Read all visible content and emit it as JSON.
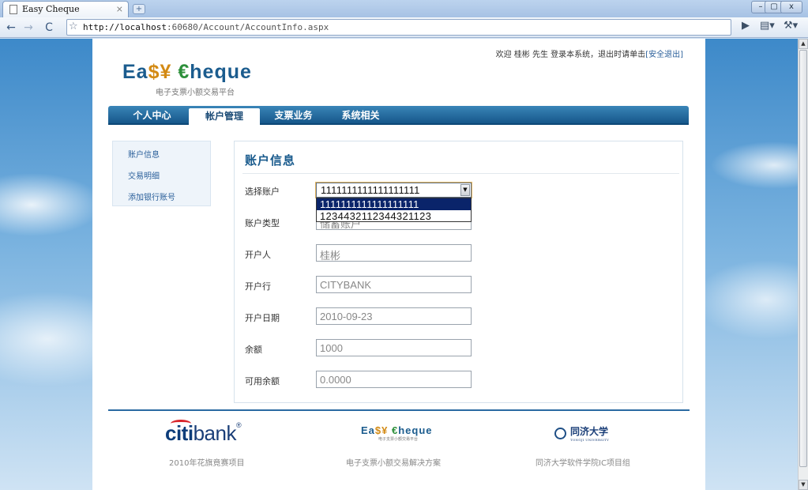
{
  "browser": {
    "tab_title": "Easy Cheque",
    "tab_close": "×",
    "url_host": "http://localhost",
    "url_rest": ":60680/Account/AccountInfo.aspx",
    "win_min": "–",
    "win_max": "▢",
    "win_close": "x"
  },
  "header": {
    "welcome": "欢迎 桂彬 先生 登录本系统，退出时请单击",
    "logout": "[安全退出]",
    "logo": {
      "part1": "Ea",
      "cur": "$¥",
      "eur": "€",
      "part2": "heque"
    },
    "logo_sub": "电子支票小额交易平台"
  },
  "nav": [
    {
      "label": "个人中心"
    },
    {
      "label": "帐户管理",
      "active": true
    },
    {
      "label": "支票业务"
    },
    {
      "label": "系统相关"
    }
  ],
  "sidebar": {
    "items": [
      {
        "label": "账户信息"
      },
      {
        "label": "交易明细"
      },
      {
        "label": "添加银行账号"
      }
    ]
  },
  "panel": {
    "title": "账户信息",
    "select": {
      "label": "选择账户",
      "value": "1111111111111111111",
      "options": [
        "1111111111111111111",
        "1234432112344321123"
      ]
    },
    "fields": [
      {
        "label": "账户类型",
        "value": "储蓄账户"
      },
      {
        "label": "开户人",
        "value": "桂彬"
      },
      {
        "label": "开户行",
        "value": "CITYBANK"
      },
      {
        "label": "开户日期",
        "value": "2010-09-23"
      },
      {
        "label": "余额",
        "value": "1000"
      },
      {
        "label": "可用余额",
        "value": "0.0000"
      }
    ]
  },
  "footer": {
    "citi_bold": "citi",
    "citi_rest": "bank",
    "citi_mark": "®",
    "citi_caption": "2010年花旗竟赛项目",
    "logo": {
      "part1": "Ea",
      "cur": "$¥",
      "eur": "€",
      "part2": "heque"
    },
    "logo_sub": "电子支票小额交易平台",
    "logo_caption": "电子支票小额交易解决方案",
    "tongji_name": "同济大学",
    "tongji_en": "TONGJI UNIVERSITY",
    "tongji_caption": "同济大学软件学院IC项目组"
  }
}
